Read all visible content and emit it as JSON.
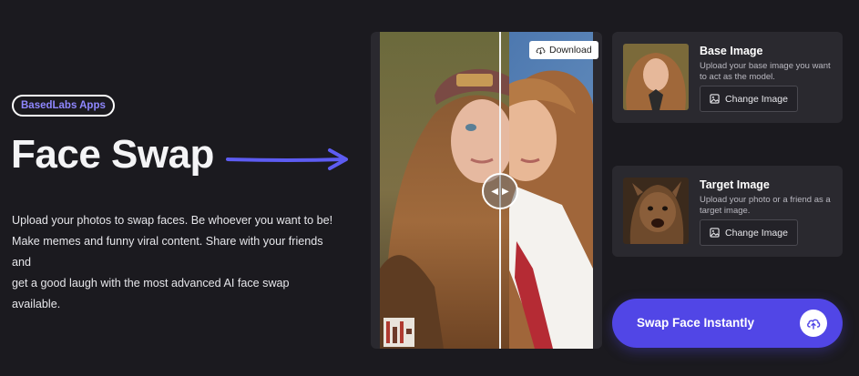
{
  "hero": {
    "badge": "BasedLabs Apps",
    "title": "Face Swap",
    "description_lines": [
      "Upload your photos to swap faces. Be whoever you want to be!",
      "Make memes and funny viral content. Share with your friends and",
      "get a good laugh with the most advanced AI face swap available."
    ]
  },
  "compare": {
    "download_label": "Download",
    "icons": {
      "download": "cloud-download-icon",
      "handle": "compare-arrows-icon",
      "watermark": "watermark-logo"
    }
  },
  "base_card": {
    "title": "Base Image",
    "description": "Upload your base image you want to act as the model.",
    "button_label": "Change Image",
    "icon": "image-icon"
  },
  "target_card": {
    "title": "Target Image",
    "description": "Upload your photo or a friend as a target image.",
    "button_label": "Change Image",
    "icon": "image-icon"
  },
  "swap_button": {
    "label": "Swap Face Instantly",
    "icon": "upload-cloud-icon"
  },
  "colors": {
    "background": "#1b1a1f",
    "card": "#2a292f",
    "accent": "#5146e6",
    "badge_text": "#8f87ff"
  }
}
